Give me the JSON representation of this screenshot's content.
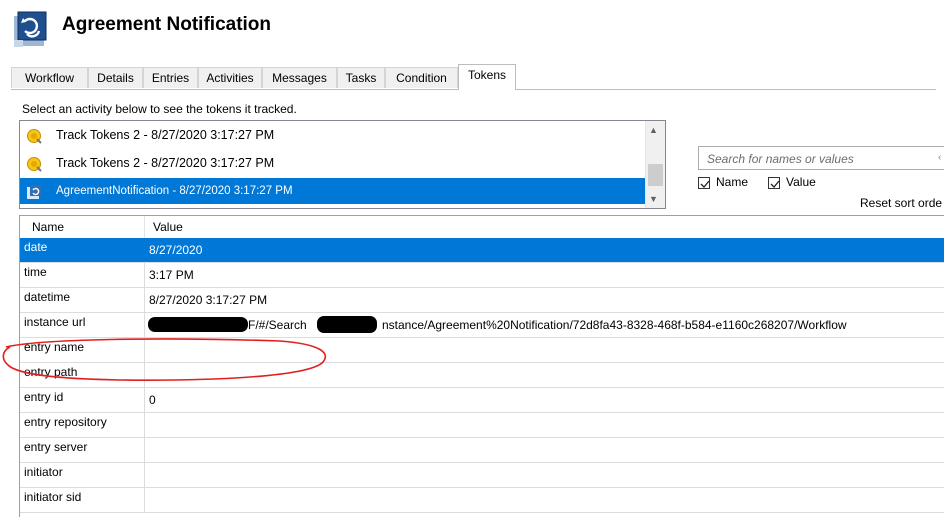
{
  "window": {
    "title": "Agreement Notification",
    "icon": "workflow-app-icon"
  },
  "tabs": [
    {
      "label": "Workflow"
    },
    {
      "label": "Details"
    },
    {
      "label": "Entries"
    },
    {
      "label": "Activities"
    },
    {
      "label": "Messages"
    },
    {
      "label": "Tasks"
    },
    {
      "label": "Condition"
    },
    {
      "label": "Tokens",
      "active": true
    }
  ],
  "instruction": "Select an activity below to see the tokens it tracked.",
  "activities": [
    {
      "label": "Track Tokens 2 - 8/27/2020 3:17:27 PM",
      "icon": "track-tokens-icon"
    },
    {
      "label": "Track Tokens 2 - 8/27/2020 3:17:27 PM",
      "icon": "track-tokens-icon"
    },
    {
      "label": "AgreementNotification - 8/27/2020 3:17:27 PM",
      "icon": "workflow-icon",
      "selected": true
    }
  ],
  "search": {
    "placeholder": "Search for names or values",
    "value": ""
  },
  "filters": {
    "name_label": "Name",
    "name_checked": true,
    "value_label": "Value",
    "value_checked": true
  },
  "reset_sort": "Reset sort orde",
  "grid": {
    "columns": [
      "Name",
      "Value"
    ],
    "rows": [
      {
        "name": "date",
        "value": "8/27/2020",
        "selected": true
      },
      {
        "name": "time",
        "value": "3:17 PM"
      },
      {
        "name": "datetime",
        "value": "8/27/2020 3:17:27 PM"
      },
      {
        "name": "instance url",
        "value": "F/#/Search",
        "value_tail": "nstance/Agreement%20Notification/72d8fa43-8328-468f-b584-e1160c268207/Workflow"
      },
      {
        "name": "entry name",
        "value": ""
      },
      {
        "name": "entry path",
        "value": ""
      },
      {
        "name": "entry id",
        "value": "0"
      },
      {
        "name": "entry repository",
        "value": ""
      },
      {
        "name": "entry server",
        "value": ""
      },
      {
        "name": "initiator",
        "value": ""
      },
      {
        "name": "initiator sid",
        "value": ""
      }
    ]
  },
  "colors": {
    "selection": "#0078d7",
    "annotation": "#e02020"
  }
}
